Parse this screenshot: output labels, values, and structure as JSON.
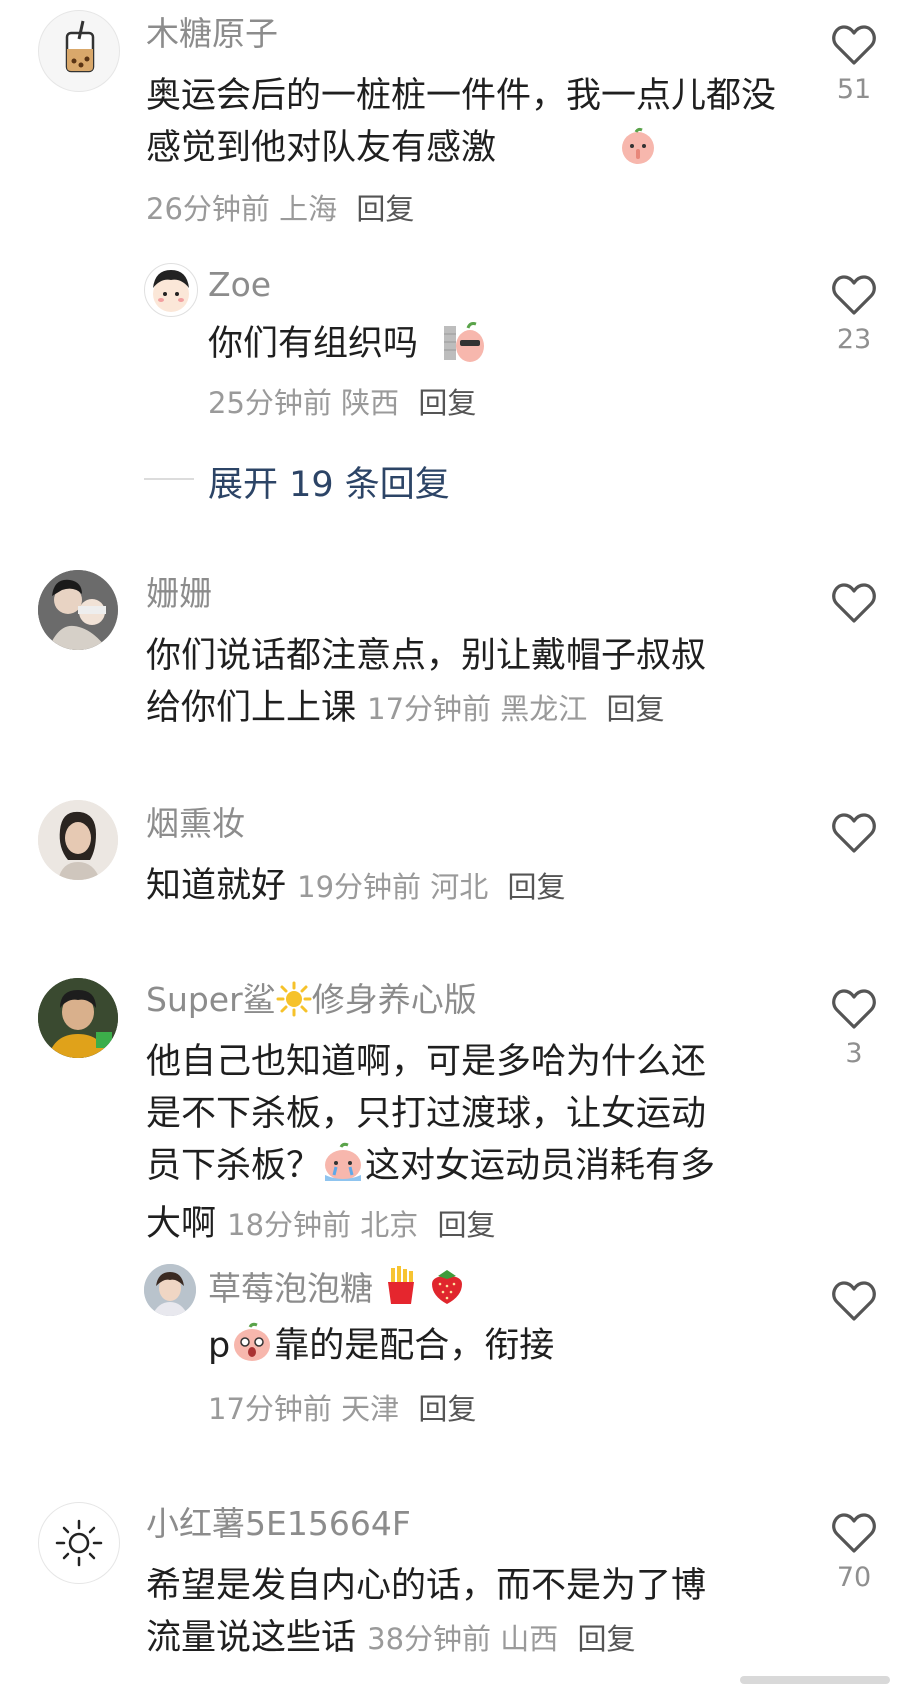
{
  "comments": [
    {
      "user": "木糖原子",
      "text": "奥运会后的一桩桩一件件，我一点儿都没感觉到他对队友有感激",
      "time": "26分钟前",
      "location": "上海",
      "reply_label": "回复",
      "likes": "51",
      "avatar_icon": "bubble-tea-icon",
      "replies": [
        {
          "user": "Zoe",
          "text": "你们有组织吗",
          "time": "25分钟前",
          "location": "陕西",
          "reply_label": "回复",
          "likes": "23",
          "avatar_icon": "cartoon-face-icon"
        }
      ],
      "expand_label": "展开 19 条回复"
    },
    {
      "user": "姗姗",
      "text_line1": "你们说话都注意点，别让戴帽子叔叔",
      "text_line2": "给你们上上课",
      "time": "17分钟前",
      "location": "黑龙江",
      "reply_label": "回复",
      "likes": "",
      "avatar_icon": "couple-photo-avatar"
    },
    {
      "user": "烟熏妆",
      "text": "知道就好",
      "time": "19分钟前",
      "location": "河北",
      "reply_label": "回复",
      "likes": "",
      "avatar_icon": "woman-photo-avatar"
    },
    {
      "user_part1": "Super鲨",
      "user_part2": "修身养心版",
      "text_line1": "他自己也知道啊，可是多哈为什么还",
      "text_line2": "是不下杀板，只打过渡球，让女运动",
      "text_line3_a": "员下杀板？",
      "text_line3_b": "这对女运动员消耗有多",
      "text_line4": "大啊",
      "time": "18分钟前",
      "location": "北京",
      "reply_label": "回复",
      "likes": "3",
      "avatar_icon": "athlete-photo-avatar",
      "replies": [
        {
          "user": "草莓泡泡糖",
          "text_a": "p",
          "text_b": "靠的是配合，衔接",
          "time": "17分钟前",
          "location": "天津",
          "reply_label": "回复",
          "likes": "",
          "avatar_icon": "girl-photo-avatar"
        }
      ]
    },
    {
      "user": "小红薯5E15664F",
      "text_line1": "希望是发自内心的话，而不是为了博",
      "text_line2": "流量说这些话",
      "time": "38分钟前",
      "location": "山西",
      "reply_label": "回复",
      "likes": "70",
      "avatar_icon": "sun-icon"
    }
  ],
  "colors": {
    "username": "#8c8c8c",
    "text": "#1f1f1f",
    "meta": "#9a9a9a",
    "expand": "#2c4466",
    "heart": "#555555"
  }
}
